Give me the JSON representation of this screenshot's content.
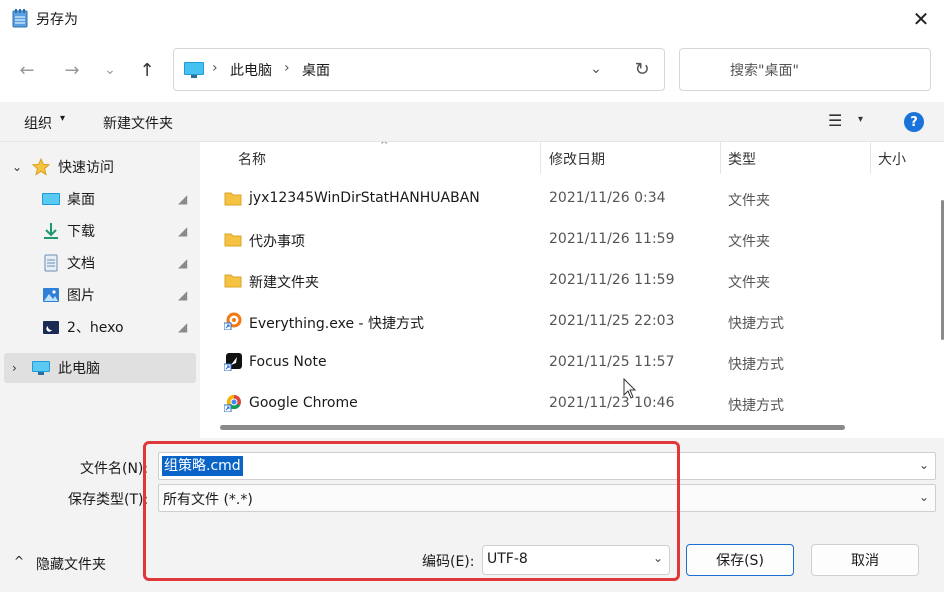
{
  "window": {
    "title": "另存为",
    "close_glyph": "✕"
  },
  "nav": {
    "back_glyph": "←",
    "forward_glyph": "→",
    "recent_glyph": "⌄",
    "up_glyph": "↑",
    "breadcrumb": [
      "此电脑",
      "桌面"
    ],
    "separator": "›",
    "dropdown_glyph": "⌄",
    "refresh_glyph": "↻",
    "search_placeholder": "搜索\"桌面\""
  },
  "toolbar": {
    "organize": "组织",
    "organize_caret": "▾",
    "new_folder": "新建文件夹",
    "view_glyph": "☰",
    "view_caret": "▾",
    "help": "?"
  },
  "sidebar": {
    "quick_access": {
      "label": "快速访问",
      "chevron": "⌄"
    },
    "items": [
      {
        "label": "桌面",
        "icon": "desktop-icon"
      },
      {
        "label": "下载",
        "icon": "download-icon"
      },
      {
        "label": "文档",
        "icon": "document-icon"
      },
      {
        "label": "图片",
        "icon": "pictures-icon"
      },
      {
        "label": "2、hexo",
        "icon": "hexo-folder-icon"
      }
    ],
    "pin_glyph": "📌",
    "this_pc": {
      "label": "此电脑",
      "chevron": "›"
    }
  },
  "columns": {
    "name": "名称",
    "date": "修改日期",
    "type": "类型",
    "size": "大小",
    "sort_caret": "^"
  },
  "files": [
    {
      "name": "jyx12345WinDirStatHANHUABAN",
      "date": "2021/11/26 0:34",
      "type": "文件夹",
      "icon": "folder-icon"
    },
    {
      "name": "代办事项",
      "date": "2021/11/26 11:59",
      "type": "文件夹",
      "icon": "folder-icon"
    },
    {
      "name": "新建文件夹",
      "date": "2021/11/26 11:59",
      "type": "文件夹",
      "icon": "folder-icon"
    },
    {
      "name": "Everything.exe - 快捷方式",
      "date": "2021/11/25 22:03",
      "type": "快捷方式",
      "icon": "everything-shortcut-icon"
    },
    {
      "name": "Focus Note",
      "date": "2021/11/25 11:57",
      "type": "快捷方式",
      "icon": "focus-note-shortcut-icon"
    },
    {
      "name": "Google Chrome",
      "date": "2021/11/23 10:46",
      "type": "快捷方式",
      "icon": "chrome-shortcut-icon"
    }
  ],
  "form": {
    "filename_label": "文件名(N):",
    "filename_value": "组策略.cmd",
    "filetype_label": "保存类型(T):",
    "filetype_value": "所有文件 (*.*)",
    "hide_folders": "隐藏文件夹",
    "hide_caret": "^",
    "encoding_label": "编码(E):",
    "encoding_value": "UTF-8",
    "dropdown_glyph": "⌄",
    "save_label": "保存(S)",
    "cancel_label": "取消"
  },
  "colors": {
    "accent": "#0a64c8",
    "highlight": "#e0373a",
    "folder": "#f5c242"
  }
}
